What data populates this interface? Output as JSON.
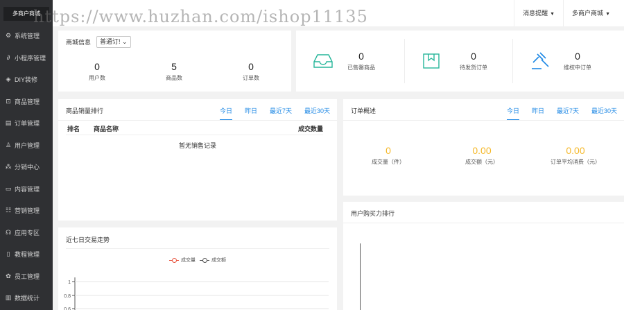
{
  "sidebar": {
    "logo": "多商户商城",
    "items": [
      {
        "label": "系统管理",
        "icon": "gear-icon"
      },
      {
        "label": "小程序管理",
        "icon": "link-icon"
      },
      {
        "label": "DIY装修",
        "icon": "diamond-icon"
      },
      {
        "label": "商品管理",
        "icon": "box-icon"
      },
      {
        "label": "订单管理",
        "icon": "document-icon"
      },
      {
        "label": "用户管理",
        "icon": "user-icon"
      },
      {
        "label": "分销中心",
        "icon": "network-icon"
      },
      {
        "label": "内容管理",
        "icon": "card-icon"
      },
      {
        "label": "营销管理",
        "icon": "wallet-icon"
      },
      {
        "label": "应用专区",
        "icon": "app-icon"
      },
      {
        "label": "教程管理",
        "icon": "book-icon"
      },
      {
        "label": "员工管理",
        "icon": "gear-solid-icon"
      },
      {
        "label": "数据统计",
        "icon": "bar-chart-icon"
      }
    ]
  },
  "topbar": {
    "notifications": "消息提醒",
    "shop_switch": "多商户商城"
  },
  "watermark": "https://www.huzhan.com/ishop11135",
  "shop_info": {
    "title": "商城信息",
    "select_value": "普通订!",
    "stats": [
      {
        "value": "0",
        "label": "用户数"
      },
      {
        "value": "5",
        "label": "商品数"
      },
      {
        "value": "0",
        "label": "订单数"
      }
    ]
  },
  "status": {
    "items": [
      {
        "value": "0",
        "label": "已售罄商品",
        "icon": "inbox-icon"
      },
      {
        "value": "0",
        "label": "待发货订单",
        "icon": "package-icon"
      },
      {
        "value": "0",
        "label": "维权中订单",
        "icon": "gavel-icon"
      }
    ],
    "accent": "#26b69a",
    "accent2": "#1e88e5"
  },
  "sales_rank": {
    "title": "商品销量排行",
    "tabs": [
      "今日",
      "昨日",
      "最近7天",
      "最近30天"
    ],
    "columns": [
      "排名",
      "商品名称",
      "成交数量"
    ],
    "empty": "暂无销售记录"
  },
  "order_overview": {
    "title": "订单概述",
    "tabs": [
      "今日",
      "昨日",
      "最近7天",
      "最近30天"
    ],
    "stats": [
      {
        "value": "0",
        "label": "成交量（件）"
      },
      {
        "value": "0.00",
        "label": "成交额（元）"
      },
      {
        "value": "0.00",
        "label": "订单平均消费（元）"
      }
    ],
    "value_color": "#f5b829"
  },
  "purchase_rank": {
    "title": "用户购买力排行"
  },
  "trend": {
    "title": "近七日交易走势",
    "legend": [
      {
        "label": "成交量",
        "color": "#e8533d"
      },
      {
        "label": "成交额",
        "color": "#555555"
      }
    ]
  },
  "chart_data": {
    "type": "line",
    "title": "近七日交易走势",
    "series": [
      {
        "name": "成交量",
        "values": []
      },
      {
        "name": "成交额",
        "values": []
      }
    ],
    "y_ticks": [
      "1",
      "0.8",
      "0.6"
    ],
    "ylim": [
      0,
      1
    ],
    "grid": true,
    "legend_position": "top-center"
  },
  "colors": {
    "sidebar_bg": "#2f3033",
    "tab_active": "#1e88e5"
  }
}
